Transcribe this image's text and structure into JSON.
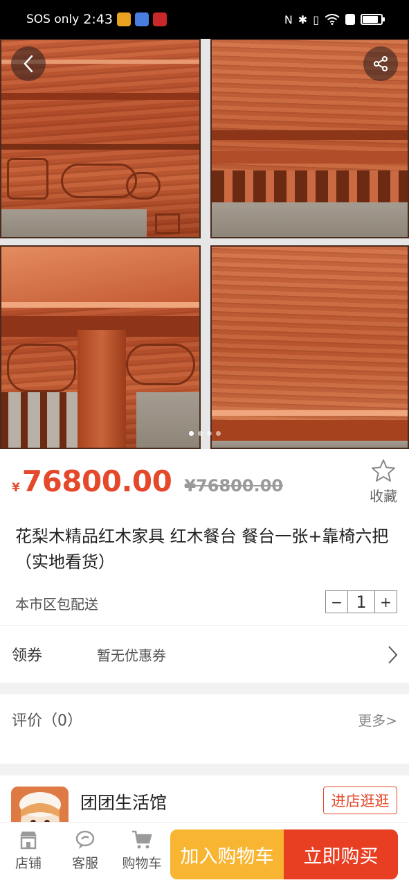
{
  "status_bar": {
    "carrier": "SOS only",
    "time": "2:43",
    "battery_level": 0.85
  },
  "gallery": {
    "dots_count": 4,
    "active_dot": 0
  },
  "product": {
    "currency": "¥",
    "price": "76800.00",
    "original_price": "¥76800.00",
    "favorite_label": "收藏",
    "title": "花梨木精品红木家具 红木餐台 餐台一张+靠椅六把（实地看货）",
    "delivery": "本市区包配送",
    "quantity": "1",
    "minus": "−",
    "plus": "+"
  },
  "coupon": {
    "label": "领券",
    "value": "暂无优惠券"
  },
  "reviews": {
    "label": "评价（0）",
    "more": "更多>"
  },
  "shop": {
    "name": "团团生活馆",
    "enter_label": "进店逛逛"
  },
  "bottom_bar": {
    "store_label": "店铺",
    "service_label": "客服",
    "cart_label": "购物车",
    "add_to_cart": "加入购物车",
    "buy_now": "立即购买"
  },
  "colors": {
    "accent": "#e4492b",
    "buy": "#e83e22",
    "cart": "#f7b532"
  },
  "icons": [
    "back-icon",
    "share-icon",
    "star-icon",
    "chevron-right-icon",
    "store-icon",
    "service-icon",
    "cart-icon"
  ]
}
